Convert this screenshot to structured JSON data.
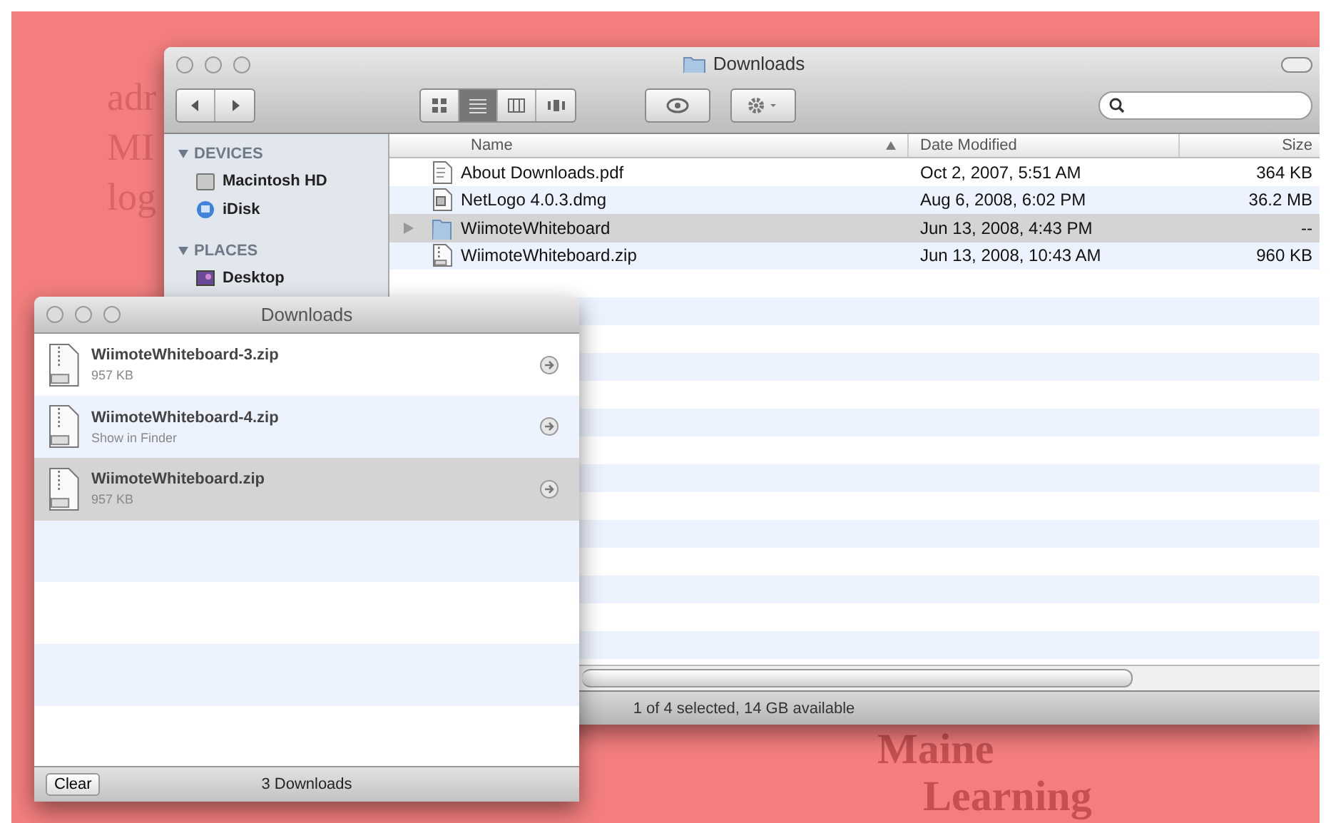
{
  "backdrop": {
    "texts": [
      "adr",
      "MI",
      "log"
    ],
    "logo": [
      "Maine",
      "Learning"
    ]
  },
  "finder": {
    "title": "Downloads",
    "view_buttons": [
      {
        "selected": false
      },
      {
        "selected": true
      },
      {
        "selected": false
      },
      {
        "selected": false
      }
    ],
    "sidebar": [
      {
        "heading": "DEVICES",
        "items": [
          {
            "label": "Macintosh HD",
            "kind": "disk"
          },
          {
            "label": "iDisk",
            "kind": "idisk"
          }
        ]
      },
      {
        "heading": "PLACES",
        "items": [
          {
            "label": "Desktop",
            "kind": "desktop"
          }
        ]
      }
    ],
    "columns": [
      "Name",
      "Date Modified",
      "Size"
    ],
    "rows": [
      {
        "name": "About Downloads.pdf",
        "date": "Oct 2, 2007, 5:51 AM",
        "size": "364 KB",
        "kind": "pdf",
        "selected": false
      },
      {
        "name": "NetLogo 4.0.3.dmg",
        "date": "Aug 6, 2008, 6:02 PM",
        "size": "36.2 MB",
        "kind": "dmg",
        "selected": false
      },
      {
        "name": "WiimoteWhiteboard",
        "date": "Jun 13, 2008, 4:43 PM",
        "size": "--",
        "kind": "folder",
        "selected": true
      },
      {
        "name": "WiimoteWhiteboard.zip",
        "date": "Jun 13, 2008, 10:43 AM",
        "size": "960 KB",
        "kind": "zip",
        "selected": false
      }
    ],
    "status": "1 of 4 selected, 14 GB available"
  },
  "downloads": {
    "title": "Downloads",
    "items": [
      {
        "name": "WiimoteWhiteboard-3.zip",
        "detail": "957 KB",
        "selected": false
      },
      {
        "name": "WiimoteWhiteboard-4.zip",
        "detail": "Show in Finder",
        "selected": false
      },
      {
        "name": "WiimoteWhiteboard.zip",
        "detail": "957 KB",
        "selected": true
      }
    ],
    "clear": "Clear",
    "count": "3 Downloads"
  }
}
